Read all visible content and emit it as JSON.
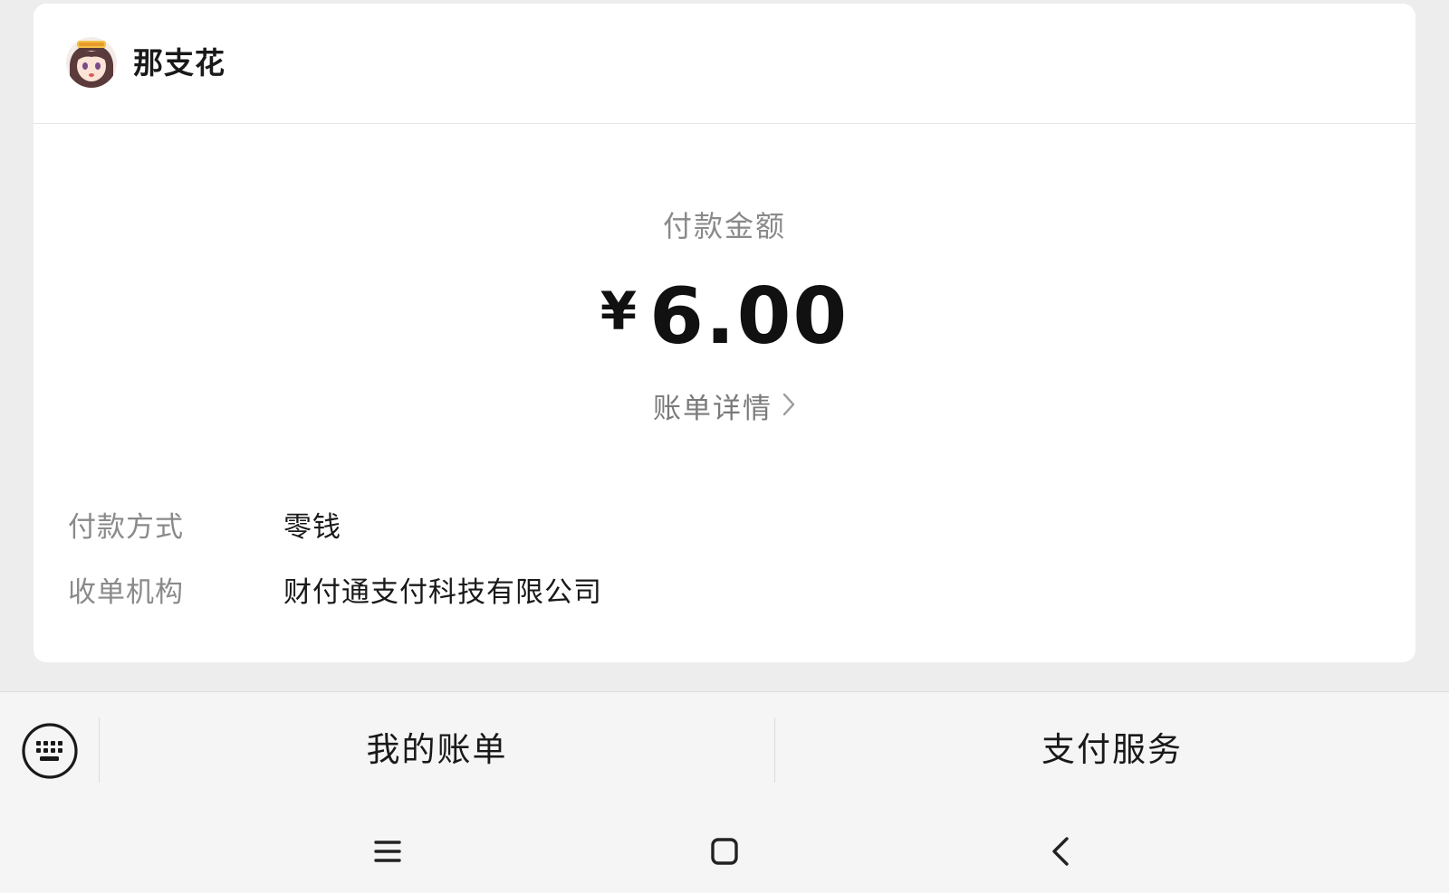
{
  "merchant": {
    "name": "那支花"
  },
  "payment": {
    "amount_label": "付款金额",
    "currency_symbol": "¥",
    "amount": "6.00",
    "bill_detail_label": "账单详情"
  },
  "details": [
    {
      "label": "付款方式",
      "value": "零钱"
    },
    {
      "label": "收单机构",
      "value": "财付通支付科技有限公司"
    }
  ],
  "bottom_menu": {
    "my_bills": "我的账单",
    "pay_service": "支付服务"
  },
  "system_nav": {
    "icons": [
      "menu-icon",
      "home-icon",
      "back-icon"
    ]
  },
  "colors": {
    "background": "#ededed",
    "card": "#ffffff",
    "text_primary": "#191919",
    "text_secondary": "#8a8a8a"
  }
}
